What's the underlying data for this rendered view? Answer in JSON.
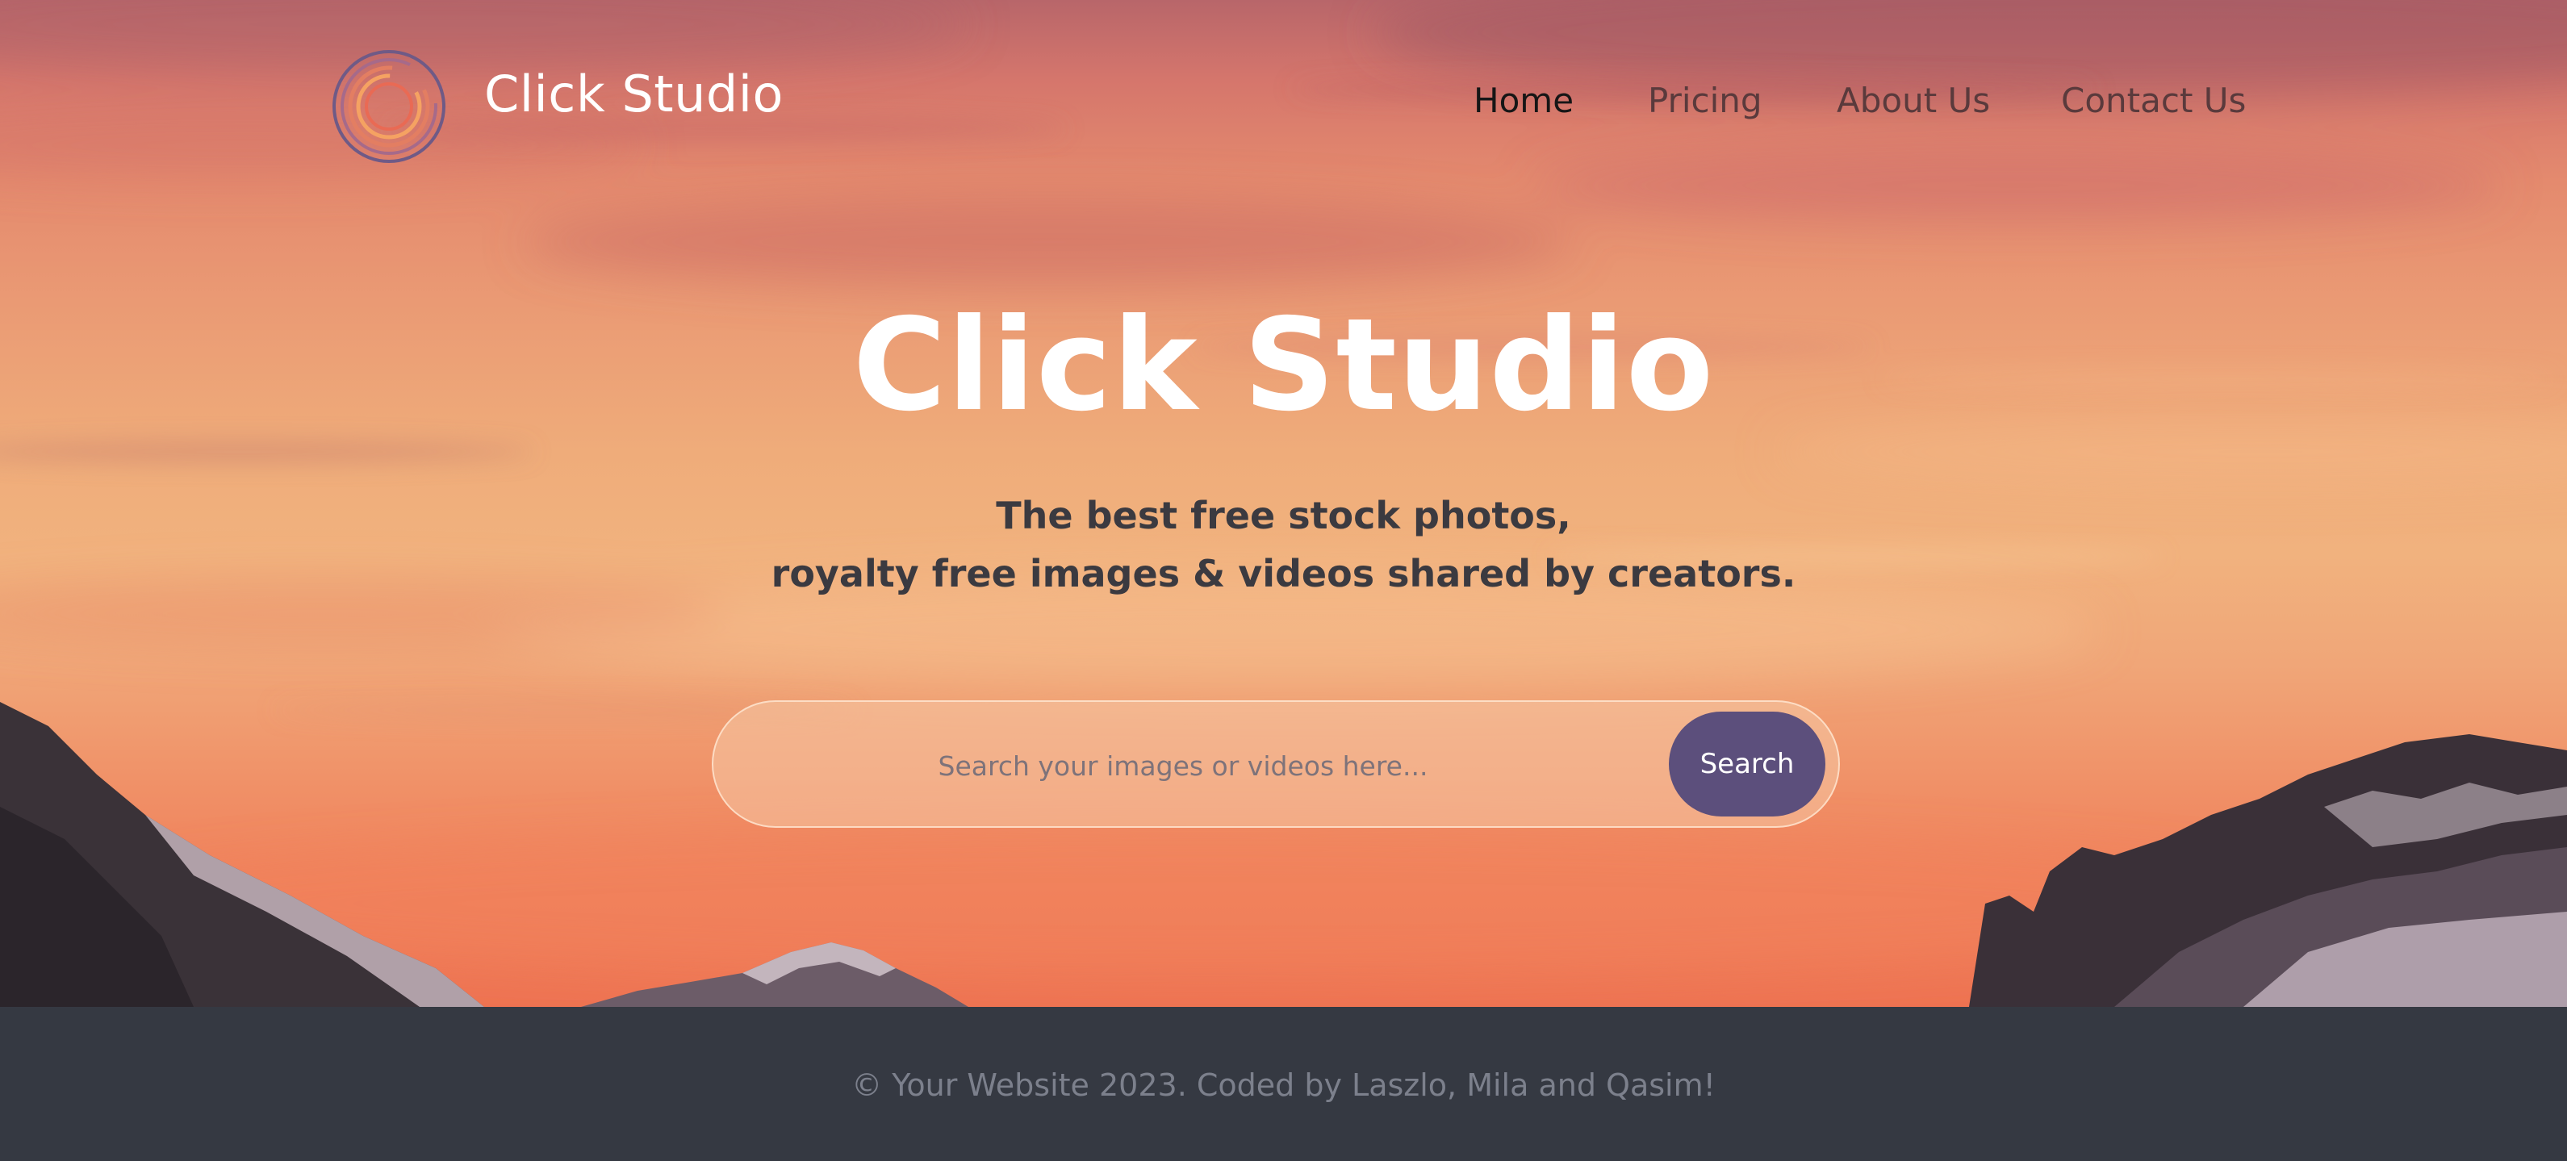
{
  "header": {
    "logo_icon": "concentric-circles-logo",
    "brand_name": "Click Studio"
  },
  "nav": {
    "items": [
      {
        "label": "Home",
        "active": true
      },
      {
        "label": "Pricing",
        "active": false
      },
      {
        "label": "About Us",
        "active": false
      },
      {
        "label": "Contact Us",
        "active": false
      }
    ]
  },
  "hero": {
    "title": "Click Studio",
    "tagline_line1": "The best free stock photos,",
    "tagline_line2": "royalty free images & videos shared by creators."
  },
  "search": {
    "placeholder": "Search your images or videos here...",
    "value": "",
    "button_label": "Search"
  },
  "footer": {
    "text": "© Your Website 2023. Coded by Laszlo, Mila and Qasim!"
  },
  "colors": {
    "accent": "#5c4f7c",
    "footer_bg": "#353942",
    "sky_top": "#b8666a",
    "sky_bottom": "#ee7352"
  }
}
